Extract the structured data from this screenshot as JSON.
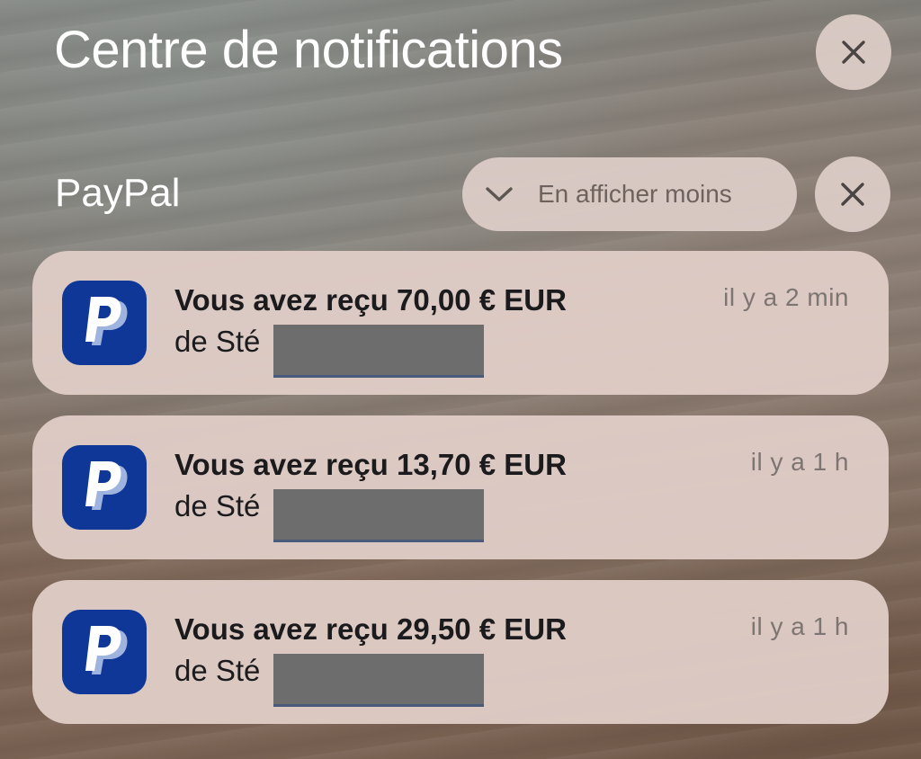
{
  "header": {
    "title": "Centre de notifications"
  },
  "group": {
    "app_name": "PayPal",
    "show_less_label": "En afficher moins"
  },
  "notifications": [
    {
      "title": "Vous avez reçu 70,00 € EUR",
      "subtitle": "de Sté",
      "time": "il y a 2 min"
    },
    {
      "title": "Vous avez reçu 13,70 € EUR",
      "subtitle": "de Sté",
      "time": "il y a 1 h"
    },
    {
      "title": "Vous avez reçu 29,50 € EUR",
      "subtitle": "de Sté",
      "time": "il y a 1 h"
    }
  ],
  "icons": {
    "close": "close-icon",
    "chevron": "chevron-down-icon",
    "app": "paypal-icon"
  },
  "colors": {
    "paypal_blue": "#0f3797",
    "card_bg": "#dfccc6",
    "text_dark": "#1b1b1d",
    "text_muted": "#7d7572"
  }
}
